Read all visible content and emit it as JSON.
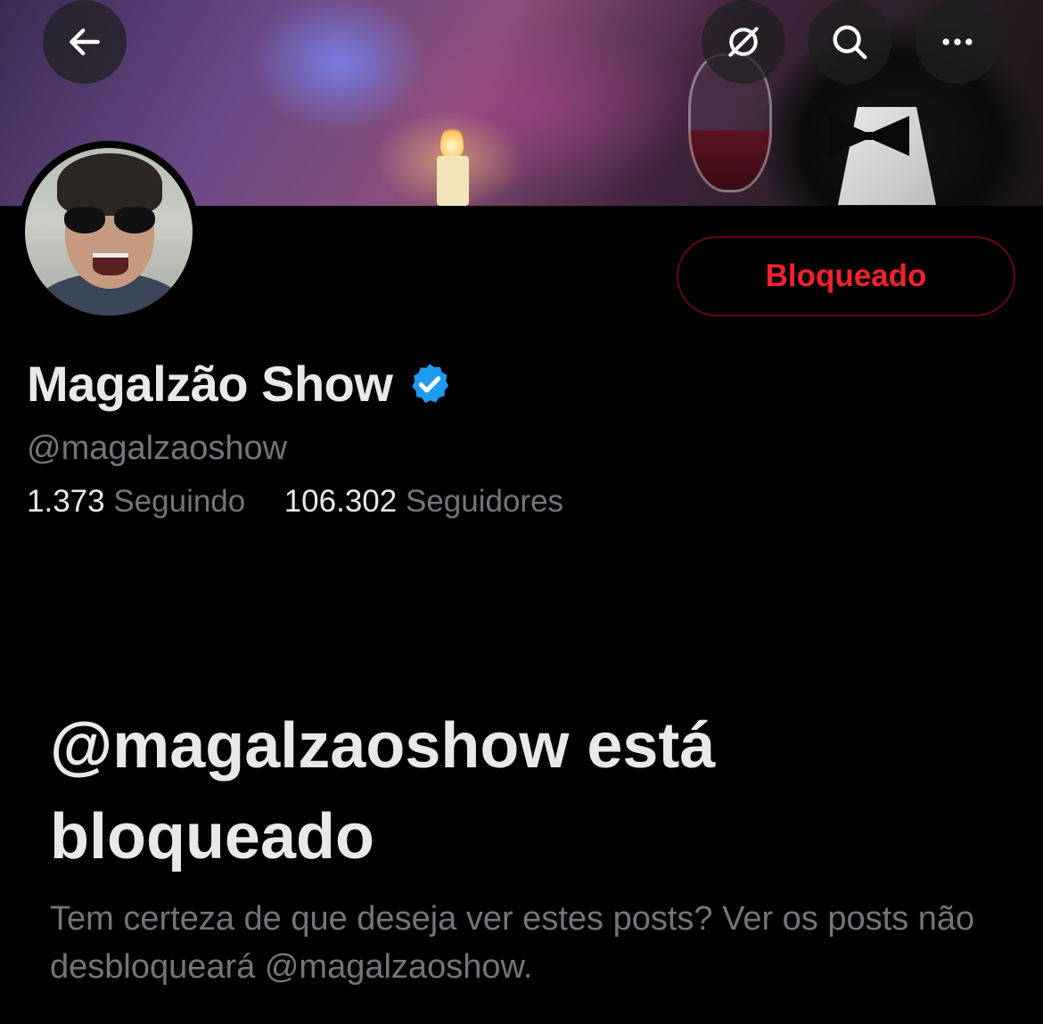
{
  "header": {
    "back_icon": "arrow-left-icon",
    "grok_icon": "grok-icon",
    "search_icon": "search-icon",
    "more_icon": "more-horizontal-icon"
  },
  "profile": {
    "block_button_label": "Bloqueado",
    "display_name": "Magalzão Show",
    "verified_icon": "verified-badge-icon",
    "handle": "@magalzaoshow",
    "following_count": "1.373",
    "following_label": "Seguindo",
    "followers_count": "106.302",
    "followers_label": "Seguidores"
  },
  "blocked_notice": {
    "title": "@magalzaoshow está bloqueado",
    "description": "Tem certeza de que deseja ver estes posts? Ver os posts não desbloqueará @magalzaoshow."
  },
  "colors": {
    "background": "#000000",
    "text_primary": "#e7e9ea",
    "text_secondary": "#71767b",
    "blocked_red": "#f4212e",
    "blocked_border": "#67070f",
    "verified_blue": "#1d9bf0"
  }
}
